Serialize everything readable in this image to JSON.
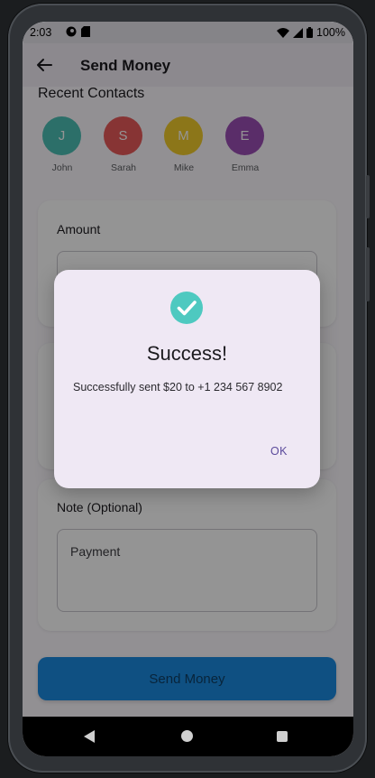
{
  "status_bar": {
    "time": "2:03",
    "battery": "100%"
  },
  "app_bar": {
    "title": "Send Money"
  },
  "recent_contacts": {
    "title": "Recent Contacts",
    "contacts": [
      {
        "initial": "J",
        "name": "John",
        "color": "#4dbfb6"
      },
      {
        "initial": "S",
        "name": "Sarah",
        "color": "#e85b5b"
      },
      {
        "initial": "M",
        "name": "Mike",
        "color": "#f2cb2c"
      },
      {
        "initial": "E",
        "name": "Emma",
        "color": "#9b4fb5"
      }
    ]
  },
  "amount": {
    "label": "Amount"
  },
  "note": {
    "label": "Note (Optional)",
    "value": "Payment"
  },
  "send_button": {
    "label": "Send Money",
    "color": "#1b8be0"
  },
  "dialog": {
    "title": "Success!",
    "message": "Successfully sent $20 to +1 234 567 8902",
    "ok_label": "OK",
    "icon": "check-circle-icon",
    "icon_color": "#4ec9c0"
  }
}
